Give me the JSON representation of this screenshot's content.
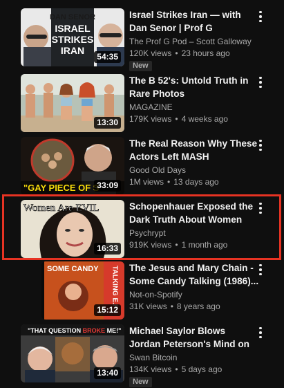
{
  "videos": [
    {
      "title": "Israel Strikes Iran — with Dan Senor | Prof G Conversations",
      "channel": "The Prof G Pod – Scott Galloway",
      "views": "120K views",
      "age": "23 hours ago",
      "duration": "54:35",
      "badge": "New",
      "thumb_text": [
        "DAN SENOR",
        "ISRAEL",
        "STRIKES",
        "IRAN"
      ]
    },
    {
      "title": "The B 52's: Untold Truth in Rare Photos",
      "channel": "MAGAZINE",
      "views": "179K views",
      "age": "4 weeks ago",
      "duration": "13:30"
    },
    {
      "title": "The Real Reason Why These Actors Left MASH",
      "channel": "Good Old Days",
      "views": "1M views",
      "age": "13 days ago",
      "duration": "33:09",
      "thumb_text": [
        "\"GAY PIECE OF S"
      ]
    },
    {
      "title": "Schopenhauer Exposed the Dark Truth About Women (Tha...",
      "channel": "Psychrypt",
      "views": "919K views",
      "age": "1 month ago",
      "duration": "16:33",
      "thumb_text": [
        "Women Are EVIL"
      ]
    },
    {
      "title": "The Jesus and Mary Chain - Some Candy Talking (1986)...",
      "channel": "Not-on-Spotify",
      "views": "31K views",
      "age": "8 years ago",
      "duration": "15:12",
      "thumb_text": [
        "SOME CANDY",
        "TALKING E.P."
      ]
    },
    {
      "title": "Michael Saylor Blows Jordan Peterson's Mind on Bitcoin",
      "channel": "Swan Bitcoin",
      "views": "134K views",
      "age": "5 days ago",
      "duration": "13:40",
      "badge": "New",
      "thumb_text": [
        "\"THAT QUESTION ",
        "BROKE",
        " ME!\""
      ]
    }
  ],
  "colors": {
    "background": "#0f0f0f",
    "title": "#f1f1f1",
    "meta": "#aaaaaa",
    "badge_bg": "#272727",
    "highlight": "#e73323"
  },
  "icons": {
    "more": "more-vert-icon"
  }
}
